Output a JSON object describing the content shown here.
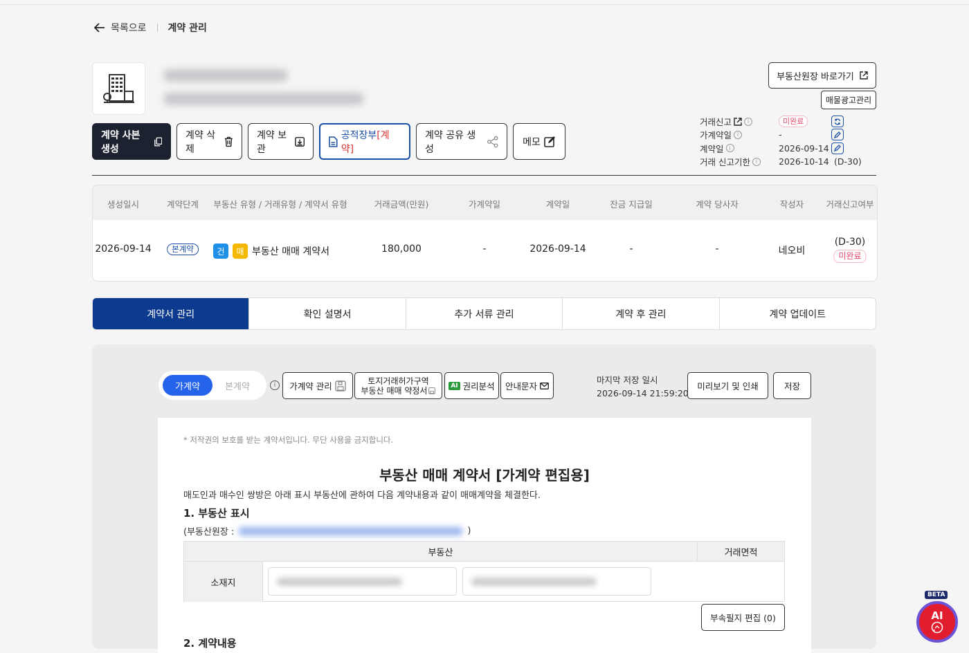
{
  "breadcrumb": {
    "back": "목록으로",
    "current": "계약 관리"
  },
  "actions": {
    "copy": "계약 사본 생성",
    "delete": "계약 삭제",
    "archive": "계약 보관",
    "ledger_main": "공적장부",
    "ledger_tag": "[계약]",
    "share": "계약 공유 생성",
    "memo": "메모"
  },
  "right": {
    "registry_link": "부동산원장 바로가기",
    "ad_manage": "매물광고관리",
    "report_label": "거래신고",
    "report_status": "미완료",
    "prov_label": "가계약일",
    "prov_value": "-",
    "contract_label": "계약일",
    "contract_value": "2026-09-14",
    "deadline_label": "거래 신고기한",
    "deadline_value": "2026-10-14",
    "deadline_dday": "(D-30)"
  },
  "table": {
    "headers": [
      "생성일시",
      "계약단계",
      "부동산 유형 / 거래유형 / 계약서 유형",
      "거래금액(만원)",
      "가계약일",
      "계약일",
      "잔금 지급일",
      "계약 당사자",
      "작성자",
      "거래신고여부"
    ],
    "row": {
      "created": "2026-09-14",
      "stage": "본계약",
      "type_badge_1": "건",
      "type_badge_2": "매",
      "contract_type": "부동산 매매 계약서",
      "amount": "180,000",
      "prov_date": "-",
      "contract_date": "2026-09-14",
      "balance_date": "-",
      "parties": "-",
      "writer": "네오비",
      "report_dday": "(D-30)",
      "report_status": "미완료"
    }
  },
  "tabs": [
    "계약서 관리",
    "확인 설명서",
    "추가 서류 관리",
    "계약 후 관리",
    "계약 업데이트"
  ],
  "editor": {
    "toggle_on": "가계약",
    "toggle_off": "본계약",
    "manage_prov": "가계약 관리",
    "land_line1": "토지거래허가구역",
    "land_line2": "부동산 매매 약정서",
    "ai_tag": "AI",
    "rights": "권리분석",
    "notice": "안내문자",
    "last_save_label": "마지막 저장 일시",
    "last_save_value": "2026-09-14 21:59:20",
    "preview": "미리보기 및 인쇄",
    "save": "저장"
  },
  "document": {
    "copyright": "* 저작권의 보호를 받는 계약서입니다. 무단 사용을 금지합니다.",
    "title": "부동산 매매 계약서 [가계약 편집용]",
    "intro": "매도인과 매수인 쌍방은 아래 표시 부동산에 관하여 다음 계약내용과 같이 매매계약을 체결한다.",
    "section1": "1. 부동산 표시",
    "registry_prefix": "(부동산원장 :",
    "registry_suffix": ")",
    "col_property": "부동산",
    "col_area": "거래면적",
    "row_location": "소재지",
    "annex_button": "부속필지 편집 (0)",
    "section2": "2. 계약내용"
  },
  "ai_widget": {
    "beta": "BETA",
    "label": "AI"
  },
  "colors": {
    "navy": "#0b3a8e",
    "dark": "#1c2230",
    "primary": "#2563eb",
    "alert": "#e14a6c"
  }
}
